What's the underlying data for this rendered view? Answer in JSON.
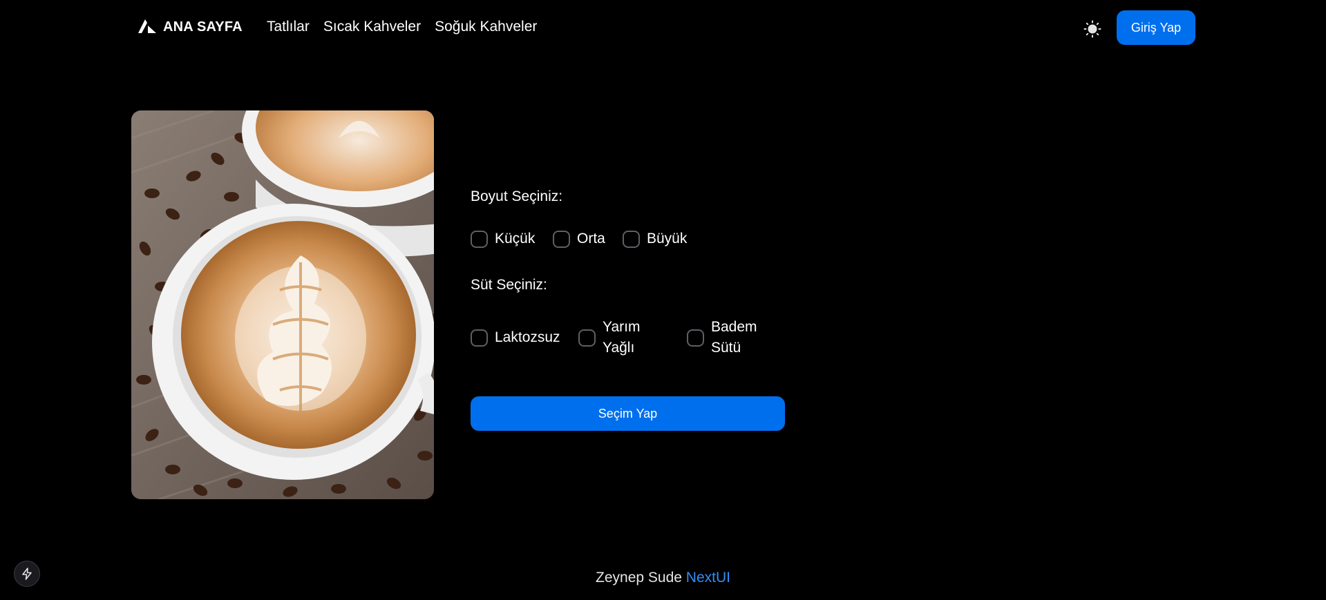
{
  "navbar": {
    "brand": "ANA SAYFA",
    "links": [
      "Tatlılar",
      "Sıcak Kahveler",
      "Soğuk Kahveler"
    ],
    "theme_icon": "sun-icon",
    "login_label": "Giriş Yap"
  },
  "product": {
    "image_icon": "coffee-latte-art-photo"
  },
  "size": {
    "label": "Boyut Seçiniz:",
    "options": [
      {
        "label": "Küçük",
        "checked": false
      },
      {
        "label": "Orta",
        "checked": false
      },
      {
        "label": "Büyük",
        "checked": false
      }
    ]
  },
  "milk": {
    "label": "Süt Seçiniz:",
    "options": [
      {
        "label": "Laktozsuz",
        "checked": false
      },
      {
        "label": "Yarım Yağlı",
        "checked": false
      },
      {
        "label": "Badem Sütü",
        "checked": false
      }
    ]
  },
  "submit_label": "Seçim Yap",
  "footer": {
    "name": "Zeynep Sude",
    "link": "NextUI"
  },
  "corner_icon": "bolt-icon",
  "colors": {
    "background": "#000000",
    "primary": "#006fee",
    "link": "#338ef7"
  }
}
